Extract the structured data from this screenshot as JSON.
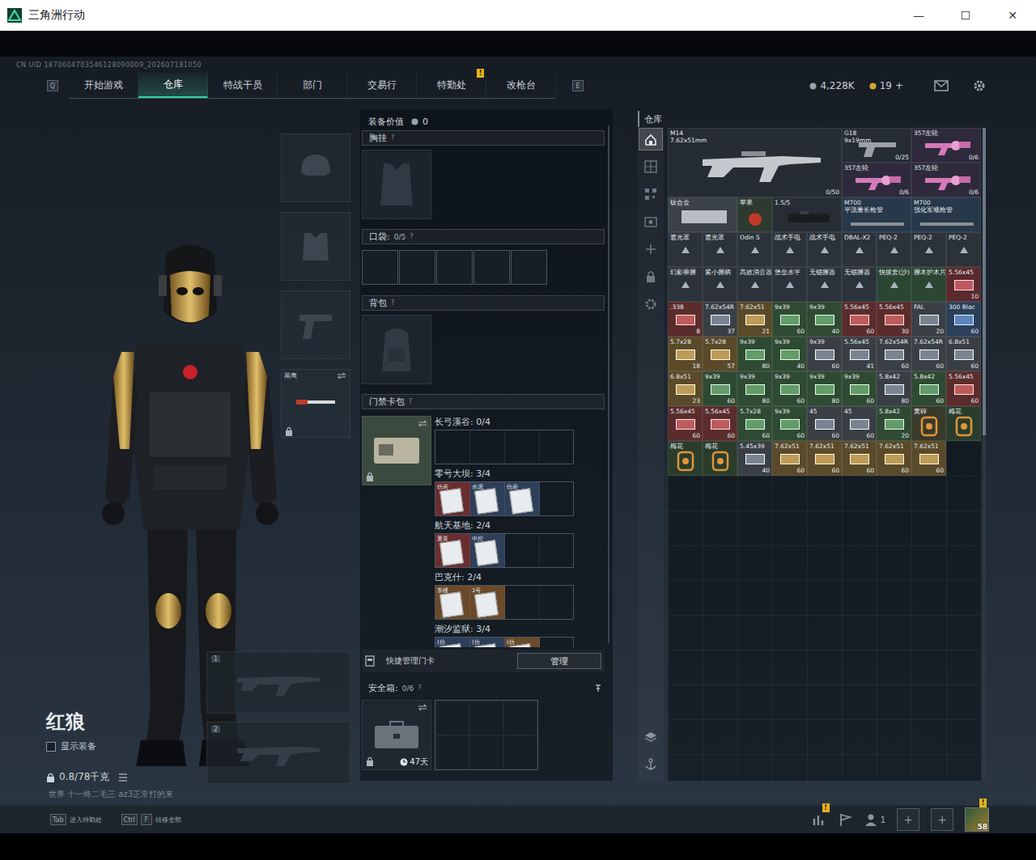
{
  "window": {
    "title": "三角洲行动",
    "controls": [
      "—",
      "☐",
      "✕"
    ]
  },
  "uid": "CN UID 1870604703546128090009_202607181050",
  "nav": {
    "left_key": "Q",
    "right_key": "E",
    "tabs": [
      {
        "label": "开始游戏",
        "selected": false
      },
      {
        "label": "仓库",
        "selected": true
      },
      {
        "label": "特战干员",
        "selected": false
      },
      {
        "label": "部门",
        "selected": false
      },
      {
        "label": "交易行",
        "selected": false
      },
      {
        "label": "特勤处",
        "selected": false,
        "badge": "!"
      },
      {
        "label": "改枪台",
        "selected": false
      }
    ],
    "currency": [
      {
        "value": "4,228K"
      },
      {
        "value": "19",
        "action": "+"
      }
    ]
  },
  "operator": {
    "name": "红狼",
    "show_equipment": {
      "label": "显示装备",
      "checked": false
    },
    "weight": "0.8/78千克",
    "chat": "世界  十一终二毛三  az3正常打的来"
  },
  "left_slots": [
    {
      "kind": "helmet",
      "locked": false
    },
    {
      "kind": "armor",
      "locked": false
    },
    {
      "kind": "pistol",
      "locked": false
    },
    {
      "kind": "melee",
      "label": "黑鹰",
      "locked": true
    }
  ],
  "weapon_slots": [
    {
      "number": "1"
    },
    {
      "number": "2"
    }
  ],
  "equipment": {
    "value_label": "装备价值",
    "value": "0",
    "chest": {
      "title": "胸挂",
      "help": "?"
    },
    "pockets": {
      "title": "口袋:",
      "count": "0/5",
      "help": "?",
      "slots": [
        {
          "filled": false
        },
        {
          "filled": false
        },
        {
          "filled": false
        },
        {
          "filled": false
        },
        {
          "filled": false
        }
      ]
    },
    "backpack": {
      "title": "背包",
      "help": "?"
    },
    "keycards": {
      "title": "门禁卡包",
      "help": "?",
      "maps": [
        {
          "label": "长弓溪谷: 0/4",
          "cards": []
        },
        {
          "label": "零号大坝: 3/4",
          "cards": [
            {
              "label": "仿若",
              "color": "#6a2e30"
            },
            {
              "label": "水泥",
              "color": "#2e3f5a"
            },
            {
              "label": "仿若",
              "color": "#2e3f5a"
            }
          ]
        },
        {
          "label": "航天基地: 2/4",
          "cards": [
            {
              "label": "重要",
              "color": "#6a2e30"
            },
            {
              "label": "中控",
              "color": "#2e3f5a"
            }
          ]
        },
        {
          "label": "巴克什: 2/4",
          "cards": [
            {
              "label": "东楼",
              "color": "#6a4a2a"
            },
            {
              "label": "1号",
              "color": "#6a4a2a"
            }
          ]
        },
        {
          "label": "潮汐监狱: 3/4",
          "cards": [
            {
              "label": "(仿",
              "color": "#2e3f5a"
            },
            {
              "label": "(仿",
              "color": "#2e3f5a"
            },
            {
              "label": "(仿",
              "color": "#6a4a2a"
            }
          ]
        }
      ]
    },
    "quick": {
      "label": "快捷管理门卡",
      "button": "管理"
    },
    "safebox": {
      "title": "安全箱:",
      "count": "0/6",
      "help": "?",
      "days": "47天",
      "slots": [
        {
          "filled": false
        },
        {
          "filled": false
        },
        {
          "filled": false
        },
        {
          "filled": false
        },
        {
          "filled": false
        },
        {
          "filled": false
        }
      ]
    }
  },
  "warehouse": {
    "title": "仓库",
    "sidebar": [
      {
        "kind": "home",
        "selected": true
      },
      {
        "kind": "grid",
        "selected": false
      },
      {
        "kind": "qr",
        "selected": false
      },
      {
        "kind": "box",
        "selected": false
      },
      {
        "kind": "plus",
        "selected": false
      },
      {
        "kind": "lock",
        "selected": false
      },
      {
        "kind": "gear",
        "selected": false
      }
    ],
    "sidebar_bottom": [
      {
        "kind": "layers",
        "selected": false
      },
      {
        "kind": "anchor",
        "selected": false
      }
    ],
    "items": [
      {
        "kind": "rifle",
        "label": "M14",
        "sub": "7.62x51mm",
        "count": "0/50",
        "color": "#252c34"
      },
      {
        "kind": "pistol",
        "label": "G18",
        "sub": "9x19mm",
        "count": "0/25",
        "color": "#252c34"
      },
      {
        "kind": "revolver",
        "label": "357左轮",
        "count": "0/6",
        "color": "#2e2a3c"
      },
      {
        "kind": "revolver",
        "label": "357左轮",
        "count": "0/6",
        "color": "#2e2a3c"
      },
      {
        "kind": "revolver",
        "label": "357左轮",
        "count": "0/6",
        "color": "#2e2a3c"
      },
      {
        "kind": "plate",
        "label": "钛合金",
        "color": "#3a4148"
      },
      {
        "kind": "apple",
        "label": "苹果",
        "color": "#2d3a2f"
      },
      {
        "kind": "scope",
        "label": "1.5/5",
        "color": "#262d35"
      },
      {
        "kind": "barrel",
        "label": "M700",
        "sub": "平流量长枪管",
        "color": "#27384a"
      },
      {
        "kind": "barrel",
        "label": "M700",
        "sub": "强化军规枪管",
        "color": "#27384a"
      },
      {
        "kind": "attach",
        "label": "遮光罩",
        "color": "#2b323a"
      },
      {
        "kind": "attach",
        "label": "遮光罩",
        "color": "#2b323a"
      },
      {
        "kind": "attach",
        "label": "Odin S",
        "color": "#2b323a"
      },
      {
        "kind": "attach",
        "label": "战术手电",
        "color": "#2b323a"
      },
      {
        "kind": "attach",
        "label": "战术手电",
        "color": "#2b323a"
      },
      {
        "kind": "attach",
        "label": "DBAL-X2",
        "color": "#2b323a"
      },
      {
        "kind": "attach",
        "label": "PEQ-2",
        "color": "#2b323a"
      },
      {
        "kind": "attach",
        "label": "PEQ-2",
        "color": "#2b323a"
      },
      {
        "kind": "attach",
        "label": "PEQ-2",
        "color": "#2b323a"
      },
      {
        "kind": "attach",
        "label": "幻影垂握",
        "color": "#2b323a"
      },
      {
        "kind": "attach",
        "label": "紧小握柄",
        "color": "#2b323a"
      },
      {
        "kind": "attach",
        "label": "高效消音器",
        "color": "#2b323a"
      },
      {
        "kind": "attach",
        "label": "堡垒水平",
        "color": "#2b323a"
      },
      {
        "kind": "attach",
        "label": "无锯握器",
        "color": "#2b323a"
      },
      {
        "kind": "attach",
        "label": "无锯握器",
        "color": "#2b323a"
      },
      {
        "kind": "attach",
        "label": "快拔套(沙)",
        "color": "#2c4634"
      },
      {
        "kind": "attach",
        "label": "握木护木片",
        "color": "#2c4634"
      },
      {
        "kind": "ammo",
        "label": "5.56x45",
        "count": "10",
        "color": "#5a2a2e"
      },
      {
        "kind": "ammo",
        "label": ".338",
        "count": "8",
        "color": "#5a2c2c"
      },
      {
        "kind": "ammo",
        "label": "7.62x54R",
        "count": "37",
        "color": "#3a3f45"
      },
      {
        "kind": "ammo",
        "label": "7.62x51",
        "count": "21",
        "color": "#5a4a2a"
      },
      {
        "kind": "ammo",
        "label": "9x39",
        "count": "60",
        "color": "#2f4a32"
      },
      {
        "kind": "ammo",
        "label": "9x39",
        "count": "40",
        "color": "#2f4a32"
      },
      {
        "kind": "ammo",
        "label": "5.56x45",
        "count": "60",
        "color": "#5a2c2c"
      },
      {
        "kind": "ammo",
        "label": "5.56x45",
        "count": "30",
        "color": "#5a2c2c"
      },
      {
        "kind": "ammo",
        "label": "FAL",
        "count": "20",
        "color": "#3a3f45"
      },
      {
        "kind": "ammo",
        "label": "300 Blac",
        "count": "60",
        "color": "#2c3f5a"
      },
      {
        "kind": "ammo",
        "label": "5.7x28",
        "count": "18",
        "color": "#5a4a2a"
      },
      {
        "kind": "ammo",
        "label": "5.7x28",
        "count": "57",
        "color": "#5a4a2a"
      },
      {
        "kind": "ammo",
        "label": "9x39",
        "count": "80",
        "color": "#2f4a32"
      },
      {
        "kind": "ammo",
        "label": "9x39",
        "count": "40",
        "color": "#2f4a32"
      },
      {
        "kind": "ammo",
        "label": "9x39",
        "count": "60",
        "color": "#3a3f45"
      },
      {
        "kind": "ammo",
        "label": "5.56x45",
        "count": "41",
        "color": "#3a3f45"
      },
      {
        "kind": "ammo",
        "label": "7.62x54R",
        "count": "60",
        "color": "#3a3f45"
      },
      {
        "kind": "ammo",
        "label": "7.62x54R",
        "count": "60",
        "color": "#3a3f45"
      },
      {
        "kind": "ammo",
        "label": "6.8x51",
        "count": "60",
        "color": "#3a3f45"
      },
      {
        "kind": "ammo",
        "label": "6.8x51",
        "count": "23",
        "color": "#5a4a2a"
      },
      {
        "kind": "ammo",
        "label": "9x39",
        "count": "60",
        "color": "#2f4a32"
      },
      {
        "kind": "ammo",
        "label": "9x39",
        "count": "80",
        "color": "#2f4a32"
      },
      {
        "kind": "ammo",
        "label": "9x39",
        "count": "60",
        "color": "#2f4a32"
      },
      {
        "kind": "ammo",
        "label": "9x39",
        "count": "80",
        "color": "#2f4a32"
      },
      {
        "kind": "ammo",
        "label": "9x39",
        "count": "60",
        "color": "#2f4a32"
      },
      {
        "kind": "ammo",
        "label": "5.8x42",
        "count": "80",
        "color": "#3a3f45"
      },
      {
        "kind": "ammo",
        "label": "5.8x42",
        "count": "60",
        "color": "#2f4a32"
      },
      {
        "kind": "ammo",
        "label": "5.56x45",
        "count": "60",
        "color": "#5a2c2c"
      },
      {
        "kind": "ammo",
        "label": "5.56x45",
        "count": "60",
        "color": "#5a2c2c"
      },
      {
        "kind": "ammo",
        "label": "5.56x45",
        "count": "60",
        "color": "#5a2c2c"
      },
      {
        "kind": "ammo",
        "label": "5.7x28",
        "count": "60",
        "color": "#2f4a32"
      },
      {
        "kind": "ammo",
        "label": "9x39",
        "count": "60",
        "color": "#2f4a32"
      },
      {
        "kind": "ammo",
        "label": "45",
        "count": "60",
        "color": "#3a3f45"
      },
      {
        "kind": "ammo",
        "label": "45",
        "count": "60",
        "color": "#3a3f45"
      },
      {
        "kind": "ammo",
        "label": "5.8x42",
        "count": "20",
        "color": "#2f4a32"
      },
      {
        "kind": "token",
        "label": "黄碎",
        "color": "#3a3a2a"
      },
      {
        "kind": "token",
        "label": "梅花",
        "color": "#2a3d2c"
      },
      {
        "kind": "token",
        "label": "梅花",
        "color": "#2a3d2c"
      },
      {
        "kind": "token",
        "label": "梅花",
        "color": "#2a3d2c"
      },
      {
        "kind": "ammo",
        "label": "5.45x39",
        "count": "40",
        "color": "#3a3f45"
      },
      {
        "kind": "ammo",
        "label": "7.62x51",
        "count": "60",
        "color": "#5a4a2a"
      },
      {
        "kind": "ammo",
        "label": "7.62x51",
        "count": "60",
        "color": "#5a4a2a"
      },
      {
        "kind": "ammo",
        "label": "7.62x51",
        "count": "60",
        "color": "#5a4a2a"
      },
      {
        "kind": "ammo",
        "label": "7.62x51",
        "count": "60",
        "color": "#5a4a2a"
      },
      {
        "kind": "ammo",
        "label": "7.62x51",
        "count": "60",
        "color": "#5a4a2a"
      }
    ]
  },
  "bottom": {
    "hints": [
      {
        "keys": [
          "Tab"
        ],
        "label": "进入特勤处"
      },
      {
        "keys": [
          "Ctrl",
          "F"
        ],
        "label": "转移全部"
      }
    ],
    "buttons": [
      {
        "kind": "stats",
        "badge": "!"
      },
      {
        "kind": "flag"
      },
      {
        "kind": "squad",
        "count": "1"
      },
      {
        "kind": "add",
        "label": "+"
      },
      {
        "kind": "add",
        "label": "+"
      }
    ],
    "avatar": {
      "level": "58",
      "badge": "!"
    }
  }
}
